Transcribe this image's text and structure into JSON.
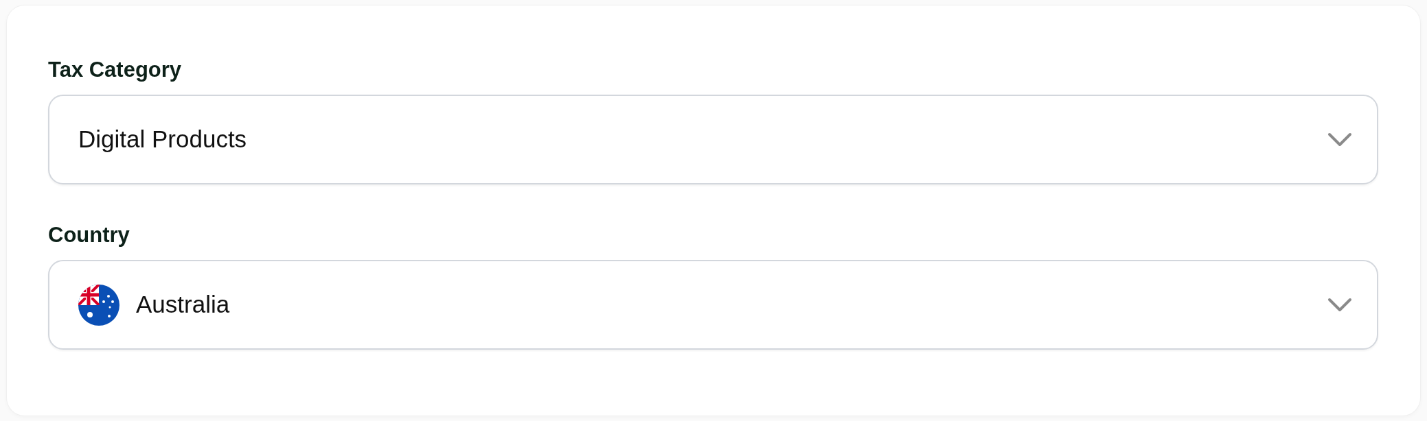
{
  "fields": [
    {
      "label": "Tax Category",
      "kind": "plain",
      "value": "Digital Products"
    },
    {
      "label": "Country",
      "kind": "flag",
      "value": "Australia"
    }
  ]
}
